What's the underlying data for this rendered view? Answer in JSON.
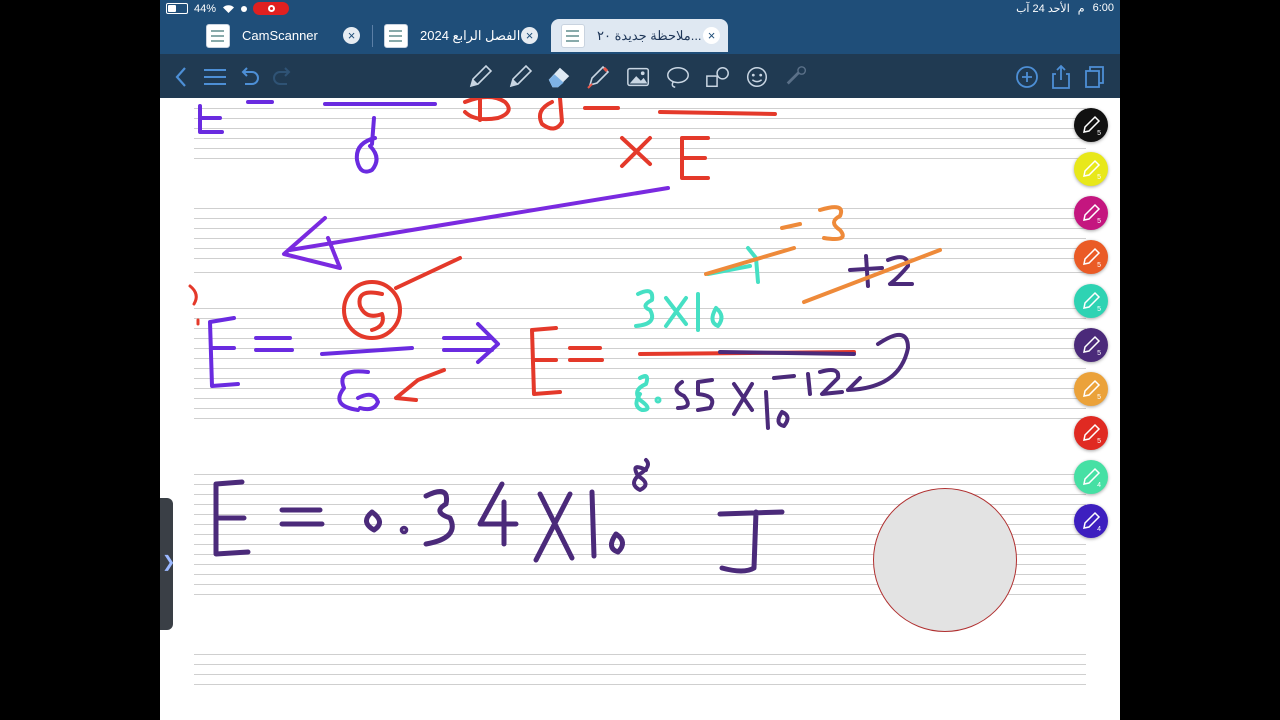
{
  "status_bar": {
    "battery": "44%",
    "time": "6:00",
    "ampm": "م",
    "date": "الأحد 24 آب"
  },
  "tabs": [
    {
      "label": "CamScanner",
      "active": false
    },
    {
      "label": "الفصل الرابع 2024",
      "active": false
    },
    {
      "label": "ملاحظة جديدة ٢٠...",
      "active": true
    }
  ],
  "toolbar": {
    "left_icons": [
      "back-icon",
      "menu-icon",
      "undo-icon",
      "redo-icon"
    ],
    "tools": [
      "pencil-tool-icon",
      "pen-tool-icon",
      "eraser-tool-icon",
      "highlighter-tool-icon",
      "image-tool-icon",
      "lasso-tool-icon",
      "shapes-tool-icon",
      "sticker-tool-icon",
      "laser-tool-icon"
    ],
    "right_icons": [
      "add-page-icon",
      "share-icon",
      "pages-icon"
    ]
  },
  "palette": [
    {
      "color": "#111111",
      "label": "5"
    },
    {
      "color": "#e8e81a",
      "label": "5"
    },
    {
      "color": "#c4167f",
      "label": "5"
    },
    {
      "color": "#ea5b26",
      "label": "5"
    },
    {
      "color": "#2ed3b3",
      "label": "5"
    },
    {
      "color": "#4b2a7a",
      "label": "5"
    },
    {
      "color": "#eba23a",
      "label": "5"
    },
    {
      "color": "#e02a22",
      "label": "5"
    },
    {
      "color": "#46e0a4",
      "label": "4"
    },
    {
      "color": "#3d1fbf",
      "label": "4"
    }
  ],
  "handwriting": {
    "line1": "E = / d  ⊕  d = / x E",
    "line2_left": "E =",
    "line2_numerator": "σ",
    "line2_denominator": "ε₀",
    "line2_right": "E =",
    "numerator": "3x10",
    "exp_crossed": "-11",
    "exp_new": "-8",
    "exp_crossed2": "+12",
    "denominator": "8.85x10",
    "denominator_exp": "-12",
    "line3": "E = 0.34 x10",
    "line3_exp": "8",
    "unit": "J"
  }
}
